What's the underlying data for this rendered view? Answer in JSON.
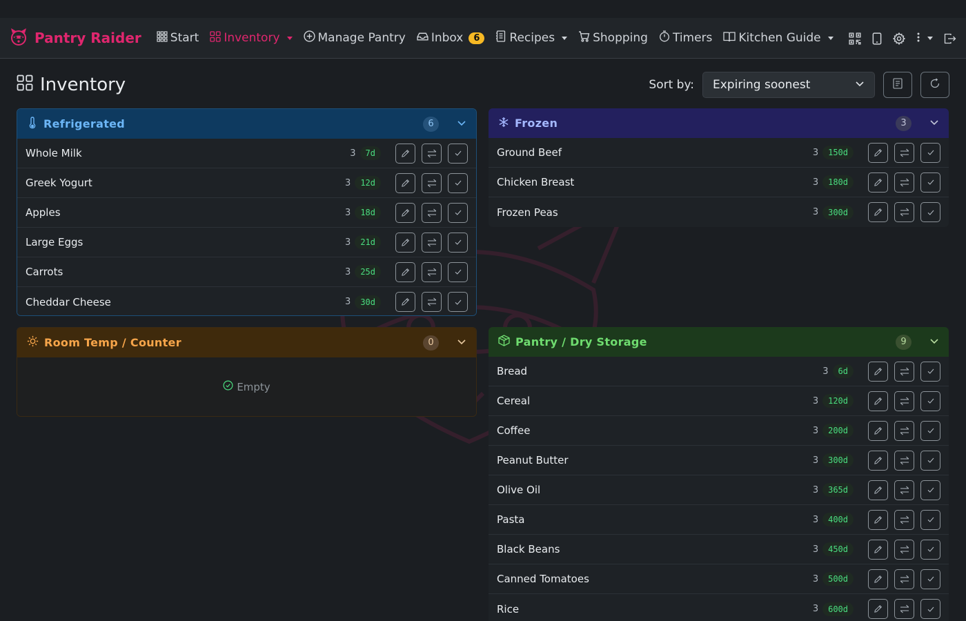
{
  "brand": {
    "name": "Pantry Raider",
    "logo_icon": "raccoon-logo-icon"
  },
  "nav": {
    "items": [
      {
        "label": "Start",
        "icon": "grid-icon"
      },
      {
        "label": "Inventory",
        "icon": "boxes-icon",
        "active": true
      },
      {
        "label": "Manage Pantry",
        "icon": "plus-circle-icon"
      },
      {
        "label": "Inbox",
        "icon": "inbox-icon",
        "badge": "6"
      },
      {
        "label": "Recipes",
        "icon": "journal-icon"
      },
      {
        "label": "Shopping",
        "icon": "cart-icon"
      },
      {
        "label": "Timers",
        "icon": "stopwatch-icon"
      },
      {
        "label": "Kitchen Guide",
        "icon": "book-icon"
      }
    ]
  },
  "page": {
    "title": "Inventory",
    "sort_label": "Sort by:",
    "sort_value": "Expiring soonest"
  },
  "sections": {
    "refrigerated": {
      "title": "Refrigerated",
      "count": "6",
      "items": [
        {
          "name": "Whole Milk",
          "qty": "3",
          "days": "7d"
        },
        {
          "name": "Greek Yogurt",
          "qty": "3",
          "days": "12d"
        },
        {
          "name": "Apples",
          "qty": "3",
          "days": "18d"
        },
        {
          "name": "Large Eggs",
          "qty": "3",
          "days": "21d"
        },
        {
          "name": "Carrots",
          "qty": "3",
          "days": "25d"
        },
        {
          "name": "Cheddar Cheese",
          "qty": "3",
          "days": "30d"
        }
      ]
    },
    "frozen": {
      "title": "Frozen",
      "count": "3",
      "items": [
        {
          "name": "Ground Beef",
          "qty": "3",
          "days": "150d"
        },
        {
          "name": "Chicken Breast",
          "qty": "3",
          "days": "180d"
        },
        {
          "name": "Frozen Peas",
          "qty": "3",
          "days": "300d"
        }
      ]
    },
    "room": {
      "title": "Room Temp / Counter",
      "count": "0",
      "empty_label": "Empty"
    },
    "pantry": {
      "title": "Pantry / Dry Storage",
      "count": "9",
      "items": [
        {
          "name": "Bread",
          "qty": "3",
          "days": "6d"
        },
        {
          "name": "Cereal",
          "qty": "3",
          "days": "120d"
        },
        {
          "name": "Coffee",
          "qty": "3",
          "days": "200d"
        },
        {
          "name": "Peanut Butter",
          "qty": "3",
          "days": "300d"
        },
        {
          "name": "Olive Oil",
          "qty": "3",
          "days": "365d"
        },
        {
          "name": "Pasta",
          "qty": "3",
          "days": "400d"
        },
        {
          "name": "Black Beans",
          "qty": "3",
          "days": "450d"
        },
        {
          "name": "Canned Tomatoes",
          "qty": "3",
          "days": "500d"
        },
        {
          "name": "Rice",
          "qty": "3",
          "days": "600d"
        }
      ]
    }
  },
  "colors": {
    "brand": "#e0266e",
    "days_badge": "#4ade80",
    "inbox_badge": "#f7b924"
  }
}
